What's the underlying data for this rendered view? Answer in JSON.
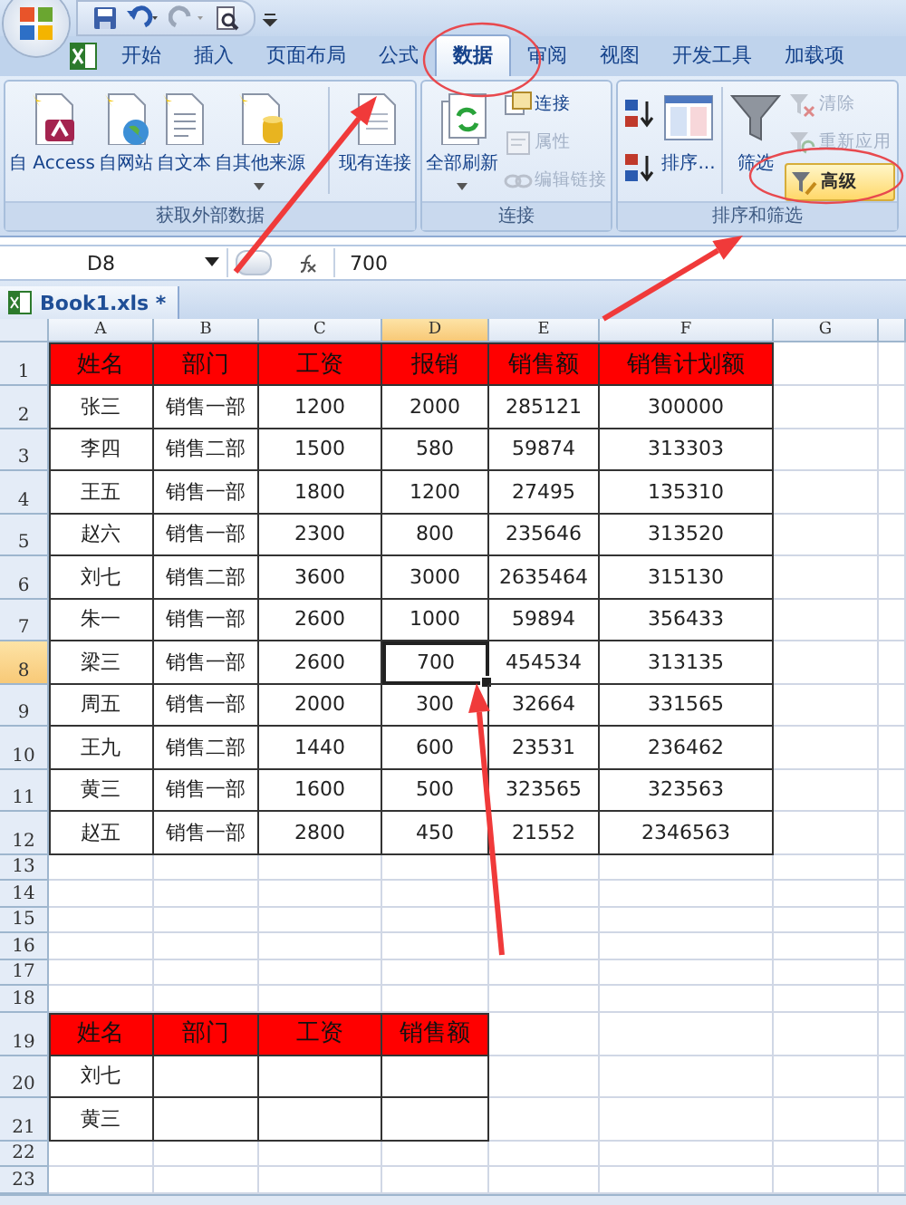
{
  "ribbon_tabs": [
    {
      "label": "开始",
      "selected": false
    },
    {
      "label": "插入",
      "selected": false
    },
    {
      "label": "页面布局",
      "selected": false
    },
    {
      "label": "公式",
      "selected": false
    },
    {
      "label": "数据",
      "selected": true
    },
    {
      "label": "审阅",
      "selected": false
    },
    {
      "label": "视图",
      "selected": false
    },
    {
      "label": "开发工具",
      "selected": false
    },
    {
      "label": "加载项",
      "selected": false
    }
  ],
  "ribbon_groups": [
    {
      "label": "获取外部数据",
      "commands": [
        {
          "kind": "large",
          "label": "自 Access",
          "disabled": false,
          "dropdown": false
        },
        {
          "kind": "large",
          "label": "自网站",
          "disabled": false,
          "dropdown": false
        },
        {
          "kind": "large",
          "label": "自文本",
          "disabled": false,
          "dropdown": false
        },
        {
          "kind": "large",
          "label": "自其他来源",
          "disabled": false,
          "dropdown": true
        },
        {
          "kind": "separator"
        },
        {
          "kind": "large",
          "label": "现有连接",
          "disabled": false,
          "dropdown": false
        }
      ]
    },
    {
      "label": "连接",
      "commands": [
        {
          "kind": "large",
          "label": "全部刷新",
          "disabled": false,
          "dropdown": true
        },
        {
          "kind": "stack",
          "items": [
            {
              "label": "连接",
              "disabled": false,
              "highlighted": false
            },
            {
              "label": "属性",
              "disabled": true,
              "highlighted": false
            },
            {
              "label": "编辑链接",
              "disabled": true,
              "highlighted": false
            }
          ]
        }
      ]
    },
    {
      "label": "排序和筛选",
      "commands": [
        {
          "kind": "sort-pair"
        },
        {
          "kind": "large",
          "label": "排序...",
          "disabled": false,
          "dropdown": false
        },
        {
          "kind": "separator"
        },
        {
          "kind": "large",
          "label": "筛选",
          "disabled": false,
          "dropdown": false
        },
        {
          "kind": "stack",
          "items": [
            {
              "label": "清除",
              "disabled": true,
              "highlighted": false
            },
            {
              "label": "重新应用",
              "disabled": true,
              "highlighted": false
            },
            {
              "label": "高级",
              "disabled": false,
              "highlighted": true
            }
          ]
        }
      ]
    }
  ],
  "name_box": "D8",
  "formula": "700",
  "workbook_tab": "Book1.xls *",
  "columns": [
    {
      "label": "A",
      "selected": false
    },
    {
      "label": "B",
      "selected": false
    },
    {
      "label": "C",
      "selected": false
    },
    {
      "label": "D",
      "selected": true
    },
    {
      "label": "E",
      "selected": false
    },
    {
      "label": "F",
      "selected": false
    },
    {
      "label": "G",
      "selected": false
    }
  ],
  "rows": [
    {
      "number": "1",
      "selected": false,
      "kind": "header",
      "cells": [
        {
          "text": "姓名",
          "selected": false
        },
        {
          "text": "部门",
          "selected": false
        },
        {
          "text": "工资",
          "selected": false
        },
        {
          "text": "报销",
          "selected": false
        },
        {
          "text": "销售额",
          "selected": false
        },
        {
          "text": "销售计划额",
          "selected": false
        }
      ]
    },
    {
      "number": "2",
      "selected": false,
      "kind": "data",
      "cells": [
        {
          "text": "张三",
          "selected": false
        },
        {
          "text": "销售一部",
          "selected": false
        },
        {
          "text": "1200",
          "selected": false
        },
        {
          "text": "2000",
          "selected": false
        },
        {
          "text": "285121",
          "selected": false
        },
        {
          "text": "300000",
          "selected": false
        }
      ]
    },
    {
      "number": "3",
      "selected": false,
      "kind": "data",
      "cells": [
        {
          "text": "李四",
          "selected": false
        },
        {
          "text": "销售二部",
          "selected": false
        },
        {
          "text": "1500",
          "selected": false
        },
        {
          "text": "580",
          "selected": false
        },
        {
          "text": "59874",
          "selected": false
        },
        {
          "text": "313303",
          "selected": false
        }
      ]
    },
    {
      "number": "4",
      "selected": false,
      "kind": "data",
      "cells": [
        {
          "text": "王五",
          "selected": false
        },
        {
          "text": "销售一部",
          "selected": false
        },
        {
          "text": "1800",
          "selected": false
        },
        {
          "text": "1200",
          "selected": false
        },
        {
          "text": "27495",
          "selected": false
        },
        {
          "text": "135310",
          "selected": false
        }
      ]
    },
    {
      "number": "5",
      "selected": false,
      "kind": "data",
      "cells": [
        {
          "text": "赵六",
          "selected": false
        },
        {
          "text": "销售一部",
          "selected": false
        },
        {
          "text": "2300",
          "selected": false
        },
        {
          "text": "800",
          "selected": false
        },
        {
          "text": "235646",
          "selected": false
        },
        {
          "text": "313520",
          "selected": false
        }
      ]
    },
    {
      "number": "6",
      "selected": false,
      "kind": "data",
      "cells": [
        {
          "text": "刘七",
          "selected": false
        },
        {
          "text": "销售二部",
          "selected": false
        },
        {
          "text": "3600",
          "selected": false
        },
        {
          "text": "3000",
          "selected": false
        },
        {
          "text": "2635464",
          "selected": false
        },
        {
          "text": "315130",
          "selected": false
        }
      ]
    },
    {
      "number": "7",
      "selected": false,
      "kind": "data",
      "cells": [
        {
          "text": "朱一",
          "selected": false
        },
        {
          "text": "销售一部",
          "selected": false
        },
        {
          "text": "2600",
          "selected": false
        },
        {
          "text": "1000",
          "selected": false
        },
        {
          "text": "59894",
          "selected": false
        },
        {
          "text": "356433",
          "selected": false
        }
      ]
    },
    {
      "number": "8",
      "selected": true,
      "kind": "data",
      "cells": [
        {
          "text": "梁三",
          "selected": false
        },
        {
          "text": "销售一部",
          "selected": false
        },
        {
          "text": "2600",
          "selected": false
        },
        {
          "text": "700",
          "selected": true
        },
        {
          "text": "454534",
          "selected": false
        },
        {
          "text": "313135",
          "selected": false
        }
      ]
    },
    {
      "number": "9",
      "selected": false,
      "kind": "data",
      "cells": [
        {
          "text": "周五",
          "selected": false
        },
        {
          "text": "销售一部",
          "selected": false
        },
        {
          "text": "2000",
          "selected": false
        },
        {
          "text": "300",
          "selected": false
        },
        {
          "text": "32664",
          "selected": false
        },
        {
          "text": "331565",
          "selected": false
        }
      ]
    },
    {
      "number": "10",
      "selected": false,
      "kind": "data",
      "cells": [
        {
          "text": "王九",
          "selected": false
        },
        {
          "text": "销售二部",
          "selected": false
        },
        {
          "text": "1440",
          "selected": false
        },
        {
          "text": "600",
          "selected": false
        },
        {
          "text": "23531",
          "selected": false
        },
        {
          "text": "236462",
          "selected": false
        }
      ]
    },
    {
      "number": "11",
      "selected": false,
      "kind": "data",
      "cells": [
        {
          "text": "黄三",
          "selected": false
        },
        {
          "text": "销售一部",
          "selected": false
        },
        {
          "text": "1600",
          "selected": false
        },
        {
          "text": "500",
          "selected": false
        },
        {
          "text": "323565",
          "selected": false
        },
        {
          "text": "323563",
          "selected": false
        }
      ]
    },
    {
      "number": "12",
      "selected": false,
      "kind": "data",
      "cells": [
        {
          "text": "赵五",
          "selected": false
        },
        {
          "text": "销售一部",
          "selected": false
        },
        {
          "text": "2800",
          "selected": false
        },
        {
          "text": "450",
          "selected": false
        },
        {
          "text": "21552",
          "selected": false
        },
        {
          "text": "2346563",
          "selected": false
        }
      ]
    },
    {
      "number": "13",
      "selected": false,
      "kind": "blank"
    },
    {
      "number": "14",
      "selected": false,
      "kind": "blank"
    },
    {
      "number": "15",
      "selected": false,
      "kind": "blank"
    },
    {
      "number": "16",
      "selected": false,
      "kind": "blank"
    },
    {
      "number": "17",
      "selected": false,
      "kind": "blank"
    },
    {
      "number": "18",
      "selected": false,
      "kind": "blank"
    },
    {
      "number": "19",
      "selected": false,
      "kind": "header",
      "cells": [
        {
          "text": "姓名",
          "selected": false
        },
        {
          "text": "部门",
          "selected": false
        },
        {
          "text": "工资",
          "selected": false
        },
        {
          "text": "销售额",
          "selected": false
        }
      ]
    },
    {
      "number": "20",
      "selected": false,
      "kind": "data",
      "cells": [
        {
          "text": "刘七",
          "selected": false
        },
        {
          "selected": false
        },
        {
          "selected": false
        },
        {
          "selected": false
        }
      ]
    },
    {
      "number": "21",
      "selected": false,
      "kind": "data",
      "cells": [
        {
          "text": "黄三",
          "selected": false
        },
        {
          "selected": false
        },
        {
          "selected": false
        },
        {
          "selected": false
        }
      ]
    },
    {
      "number": "22",
      "selected": false,
      "kind": "blank"
    },
    {
      "number": "23",
      "selected": false,
      "kind": "blank"
    }
  ],
  "annotations": [
    {
      "kind": "circle"
    },
    {
      "kind": "circle"
    },
    {
      "kind": "arrow"
    },
    {
      "kind": "arrow"
    },
    {
      "kind": "arrow"
    }
  ]
}
